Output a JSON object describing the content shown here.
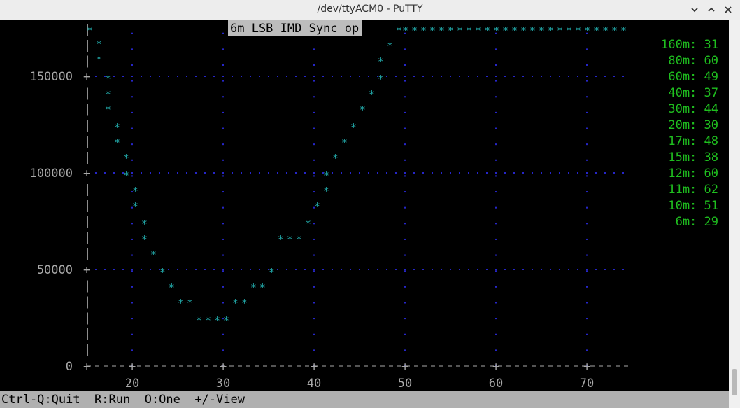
{
  "window": {
    "title": "/dev/ttyACM0 - PuTTY"
  },
  "chart_data": {
    "type": "scatter",
    "title": "6m LSB IMD Sync op",
    "x_ticks": [
      20,
      30,
      40,
      50,
      60,
      70
    ],
    "y_ticks": [
      0,
      50000,
      100000,
      150000
    ],
    "xlim": [
      15,
      75
    ],
    "ylim": [
      0,
      175000
    ],
    "points": [
      [
        15.3,
        175000
      ],
      [
        16.3,
        168000
      ],
      [
        16.3,
        160000
      ],
      [
        17.3,
        150000
      ],
      [
        17.3,
        142000
      ],
      [
        17.3,
        134000
      ],
      [
        18.3,
        125000
      ],
      [
        18.3,
        117000
      ],
      [
        19.3,
        109000
      ],
      [
        19.3,
        100000
      ],
      [
        20.3,
        92000
      ],
      [
        20.3,
        84000
      ],
      [
        21.3,
        75000
      ],
      [
        21.3,
        67000
      ],
      [
        22.3,
        59000
      ],
      [
        23.3,
        50000
      ],
      [
        24.3,
        42000
      ],
      [
        25.3,
        34000
      ],
      [
        26.3,
        34000
      ],
      [
        27.3,
        25000
      ],
      [
        28.3,
        25000
      ],
      [
        29.3,
        25000
      ],
      [
        30.3,
        25000
      ],
      [
        31.3,
        34000
      ],
      [
        32.3,
        34000
      ],
      [
        33.3,
        42000
      ],
      [
        34.3,
        42000
      ],
      [
        35.3,
        50000
      ],
      [
        36.3,
        67000
      ],
      [
        37.3,
        67000
      ],
      [
        38.3,
        67000
      ],
      [
        39.3,
        75000
      ],
      [
        40.3,
        84000
      ],
      [
        41.3,
        92000
      ],
      [
        41.3,
        100000
      ],
      [
        42.3,
        109000
      ],
      [
        43.3,
        117000
      ],
      [
        44.3,
        125000
      ],
      [
        45.3,
        134000
      ],
      [
        46.3,
        142000
      ],
      [
        47.3,
        150000
      ],
      [
        47.3,
        159000
      ],
      [
        48.3,
        167000
      ],
      [
        49.3,
        175000
      ],
      [
        50,
        175000
      ],
      [
        51,
        175000
      ],
      [
        52,
        175000
      ],
      [
        53,
        175000
      ],
      [
        54,
        175000
      ],
      [
        55,
        175000
      ],
      [
        56,
        175000
      ],
      [
        57,
        175000
      ],
      [
        58,
        175000
      ],
      [
        59,
        175000
      ],
      [
        60,
        175000
      ],
      [
        61,
        175000
      ],
      [
        62,
        175000
      ],
      [
        63,
        175000
      ],
      [
        64,
        175000
      ],
      [
        65,
        175000
      ],
      [
        66,
        175000
      ],
      [
        67,
        175000
      ],
      [
        68,
        175000
      ],
      [
        69,
        175000
      ],
      [
        70,
        175000
      ],
      [
        71,
        175000
      ],
      [
        72,
        175000
      ],
      [
        73,
        175000
      ],
      [
        74,
        175000
      ]
    ],
    "grid": true
  },
  "bands": [
    {
      "band": "160m",
      "value": "31"
    },
    {
      "band": "80m",
      "value": "60"
    },
    {
      "band": "60m",
      "value": "49"
    },
    {
      "band": "40m",
      "value": "37"
    },
    {
      "band": "30m",
      "value": "44"
    },
    {
      "band": "20m",
      "value": "30"
    },
    {
      "band": "17m",
      "value": "48"
    },
    {
      "band": "15m",
      "value": "38"
    },
    {
      "band": "12m",
      "value": "60"
    },
    {
      "band": "11m",
      "value": "62"
    },
    {
      "band": "10m",
      "value": "51"
    },
    {
      "band": "6m",
      "value": "29"
    }
  ],
  "status": {
    "text": "Ctrl-Q:Quit  R:Run  O:One  +/-View"
  },
  "colors": {
    "star": "#22a9a9",
    "grid": "#2626c8",
    "band": "#1fbf1f"
  }
}
